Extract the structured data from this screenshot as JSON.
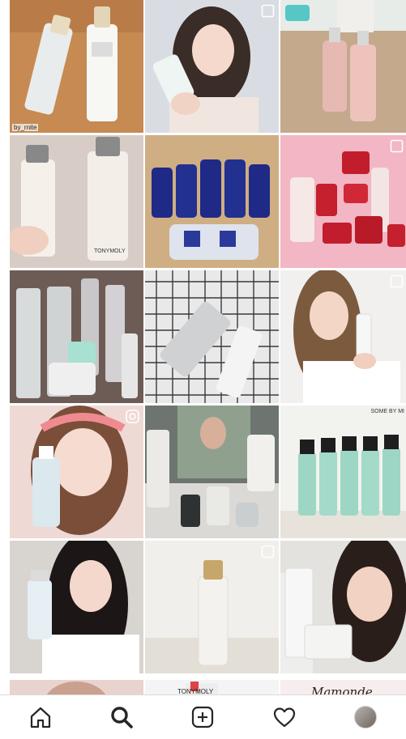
{
  "feed": {
    "tile_1": {
      "caption": "by_rnite"
    },
    "tile_2": {
      "label": "TONYMOLY"
    },
    "tile_3": {
      "label": "SOME BY MI"
    },
    "partial_left": {
      "label": "TONYMOLY"
    },
    "partial_brand": "Mamonde"
  },
  "tabbar": {
    "items": [
      {
        "name": "home",
        "icon": "home-icon"
      },
      {
        "name": "search",
        "icon": "search-icon",
        "active": true
      },
      {
        "name": "new-post",
        "icon": "plus-square-icon"
      },
      {
        "name": "activity",
        "icon": "heart-icon"
      },
      {
        "name": "profile",
        "icon": "avatar"
      }
    ]
  }
}
